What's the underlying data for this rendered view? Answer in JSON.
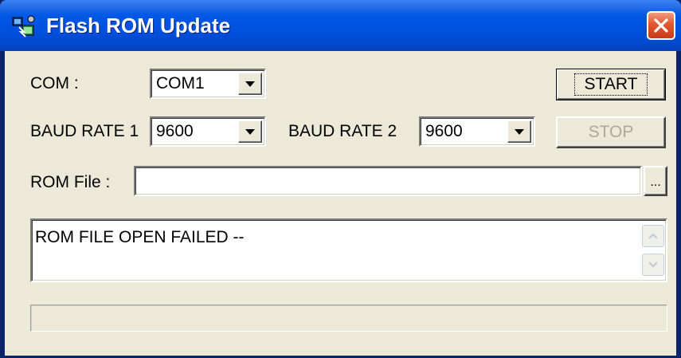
{
  "window": {
    "title": "Flash ROM Update"
  },
  "icons": {
    "app": "flash-rom-icon",
    "close": "close-icon",
    "dropdown": "chevron-down-icon",
    "scroll_up": "scroll-up-icon",
    "scroll_down": "scroll-down-icon"
  },
  "form": {
    "com_label": "COM :",
    "com_value": "COM1",
    "baud1_label": "BAUD RATE 1",
    "baud1_value": "9600",
    "baud2_label": "BAUD RATE 2",
    "baud2_value": "9600",
    "rom_file_label": "ROM File :",
    "rom_file_value": "",
    "browse_label": "..."
  },
  "buttons": {
    "start": "START",
    "stop": "STOP"
  },
  "log": {
    "text": "ROM FILE OPEN FAILED --"
  },
  "progress": {
    "value": 0
  },
  "colors": {
    "titlebar": "#0058e6",
    "close": "#e2572f",
    "face": "#ece9d8",
    "disabled_text": "#aca899"
  }
}
